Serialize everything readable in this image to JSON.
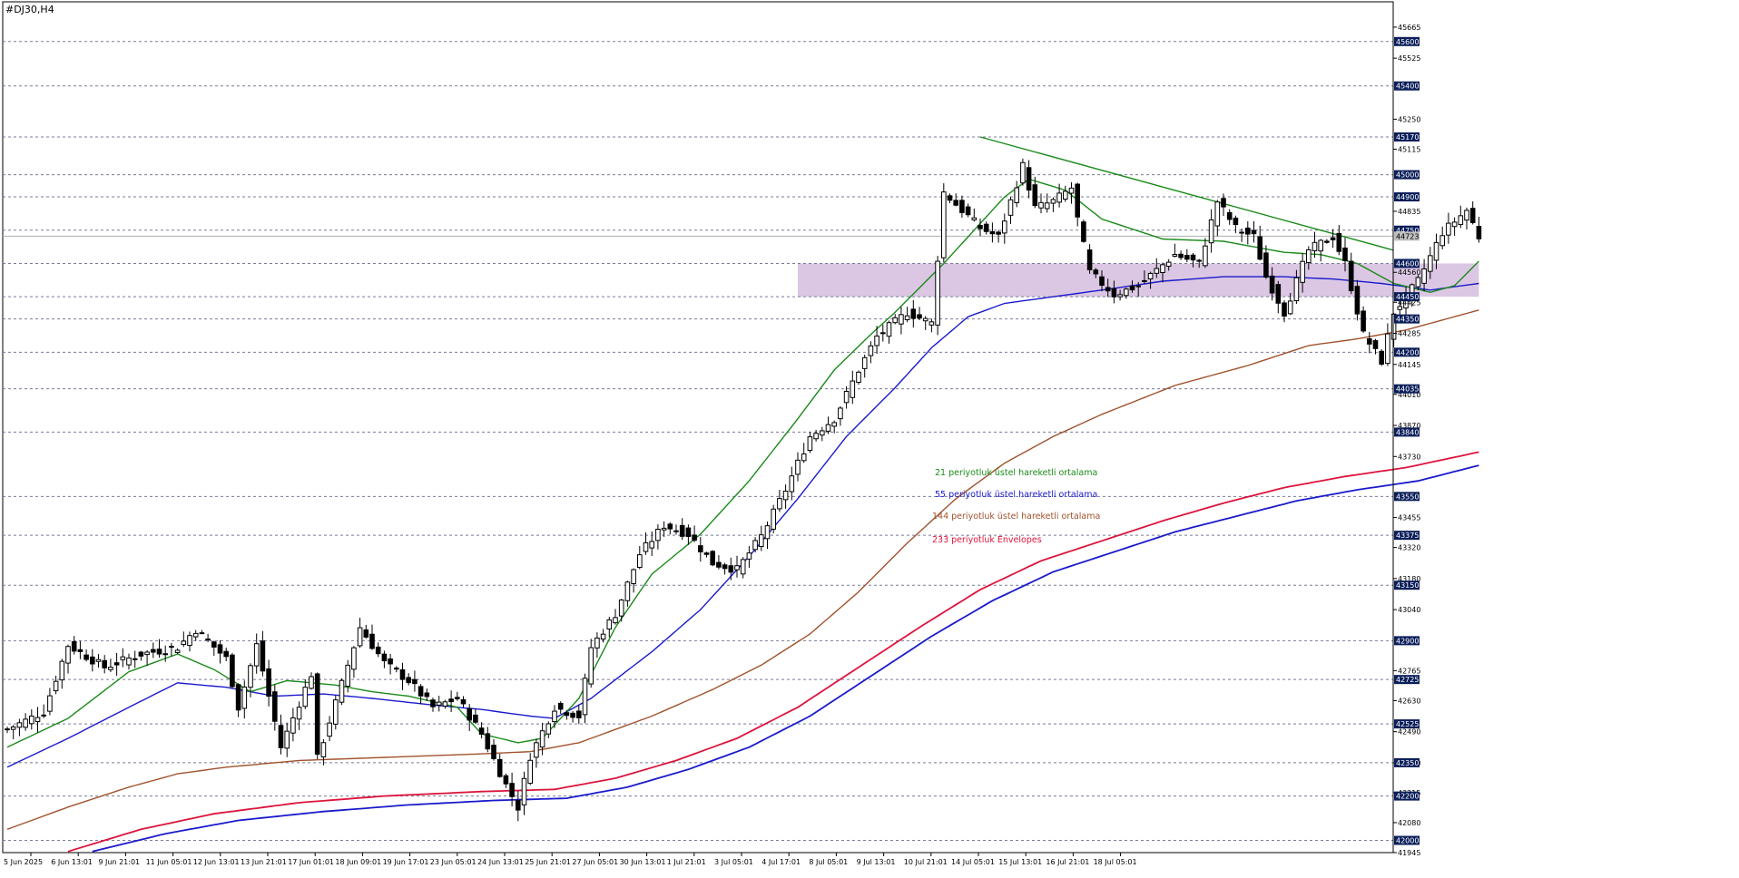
{
  "window_title": "#DJ30,H4",
  "chart_data": {
    "type": "candlestick",
    "symbol": "#DJ30",
    "timeframe": "H4",
    "ylim": [
      41945,
      45730
    ],
    "price_ticks": [
      45665,
      45525,
      45250,
      45115,
      44835,
      44560,
      44425,
      44285,
      44145,
      44010,
      43870,
      43730,
      43455,
      43320,
      43180,
      43040,
      42765,
      42630,
      42490,
      42350,
      42215,
      42080,
      41945
    ],
    "level_lines": [
      45600,
      45400,
      45170,
      45000,
      44900,
      44750,
      44600,
      44450,
      44350,
      44200,
      44035,
      43840,
      43550,
      43375,
      43150,
      42900,
      42725,
      42525,
      42350,
      42200,
      42000
    ],
    "current_price": "44723",
    "x_labels": [
      "5 Jun 2025",
      "6 Jun 13:01",
      "9 Jun 21:01",
      "11 Jun 05:01",
      "12 Jun 13:01",
      "13 Jun 21:01",
      "17 Jun 01:01",
      "18 Jun 09:01",
      "19 Jun 17:01",
      "23 Jun 05:01",
      "24 Jun 13:01",
      "25 Jun 21:01",
      "27 Jun 05:01",
      "30 Jun 13:01",
      "1 Jul 21:01",
      "3 Jul 05:01",
      "4 Jul 17:01",
      "8 Jul 05:01",
      "9 Jul 13:01",
      "10 Jul 21:01",
      "14 Jul 05:01",
      "15 Jul 13:01",
      "16 Jul 21:01",
      "18 Jul 05:01"
    ],
    "candle_anchors": [
      [
        0,
        42500
      ],
      [
        6,
        42580
      ],
      [
        10,
        42880
      ],
      [
        16,
        42780
      ],
      [
        22,
        42840
      ],
      [
        28,
        42870
      ],
      [
        31,
        42950
      ],
      [
        36,
        42820
      ],
      [
        38,
        42600
      ],
      [
        41,
        42880
      ],
      [
        45,
        42420
      ],
      [
        50,
        42750
      ],
      [
        51,
        42370
      ],
      [
        54,
        42620
      ],
      [
        58,
        42960
      ],
      [
        62,
        42800
      ],
      [
        66,
        42720
      ],
      [
        70,
        42600
      ],
      [
        74,
        42640
      ],
      [
        78,
        42480
      ],
      [
        82,
        42250
      ],
      [
        84,
        42150
      ],
      [
        86,
        42380
      ],
      [
        90,
        42600
      ],
      [
        94,
        42560
      ],
      [
        96,
        42870
      ],
      [
        100,
        43020
      ],
      [
        104,
        43290
      ],
      [
        108,
        43420
      ],
      [
        112,
        43380
      ],
      [
        116,
        43250
      ],
      [
        120,
        43220
      ],
      [
        124,
        43370
      ],
      [
        128,
        43580
      ],
      [
        132,
        43820
      ],
      [
        136,
        43900
      ],
      [
        140,
        44120
      ],
      [
        143,
        44270
      ],
      [
        148,
        44380
      ],
      [
        152,
        44330
      ],
      [
        154,
        44920
      ],
      [
        160,
        44760
      ],
      [
        163,
        44720
      ],
      [
        167,
        45040
      ],
      [
        169,
        44850
      ],
      [
        172,
        44880
      ],
      [
        175,
        44940
      ],
      [
        176,
        44800
      ],
      [
        178,
        44560
      ],
      [
        182,
        44460
      ],
      [
        186,
        44500
      ],
      [
        192,
        44640
      ],
      [
        196,
        44600
      ],
      [
        199,
        44880
      ],
      [
        202,
        44760
      ],
      [
        205,
        44720
      ],
      [
        207,
        44540
      ],
      [
        210,
        44380
      ],
      [
        214,
        44660
      ],
      [
        218,
        44720
      ],
      [
        220,
        44600
      ],
      [
        223,
        44280
      ],
      [
        226,
        44160
      ],
      [
        228,
        44380
      ],
      [
        232,
        44520
      ],
      [
        236,
        44740
      ],
      [
        240,
        44840
      ],
      [
        242,
        44720
      ]
    ],
    "ema21_anchors": [
      [
        0,
        42420
      ],
      [
        10,
        42550
      ],
      [
        20,
        42760
      ],
      [
        28,
        42840
      ],
      [
        34,
        42770
      ],
      [
        40,
        42670
      ],
      [
        46,
        42720
      ],
      [
        54,
        42700
      ],
      [
        60,
        42670
      ],
      [
        66,
        42650
      ],
      [
        74,
        42600
      ],
      [
        78,
        42480
      ],
      [
        84,
        42440
      ],
      [
        88,
        42460
      ],
      [
        94,
        42640
      ],
      [
        100,
        42960
      ],
      [
        106,
        43200
      ],
      [
        114,
        43380
      ],
      [
        122,
        43620
      ],
      [
        130,
        43900
      ],
      [
        136,
        44120
      ],
      [
        142,
        44280
      ],
      [
        146,
        44380
      ],
      [
        154,
        44600
      ],
      [
        160,
        44780
      ],
      [
        164,
        44900
      ],
      [
        168,
        44980
      ],
      [
        174,
        44930
      ],
      [
        180,
        44800
      ],
      [
        190,
        44710
      ],
      [
        200,
        44700
      ],
      [
        210,
        44650
      ],
      [
        216,
        44640
      ],
      [
        222,
        44600
      ],
      [
        228,
        44510
      ],
      [
        234,
        44470
      ],
      [
        238,
        44500
      ],
      [
        242,
        44610
      ]
    ],
    "ema55_anchors": [
      [
        0,
        42330
      ],
      [
        10,
        42460
      ],
      [
        20,
        42600
      ],
      [
        28,
        42710
      ],
      [
        36,
        42690
      ],
      [
        44,
        42650
      ],
      [
        52,
        42660
      ],
      [
        60,
        42640
      ],
      [
        70,
        42610
      ],
      [
        78,
        42590
      ],
      [
        86,
        42560
      ],
      [
        90,
        42550
      ],
      [
        96,
        42640
      ],
      [
        106,
        42850
      ],
      [
        114,
        43040
      ],
      [
        122,
        43280
      ],
      [
        130,
        43540
      ],
      [
        138,
        43820
      ],
      [
        146,
        44040
      ],
      [
        152,
        44220
      ],
      [
        158,
        44360
      ],
      [
        164,
        44420
      ],
      [
        172,
        44450
      ],
      [
        180,
        44480
      ],
      [
        190,
        44520
      ],
      [
        200,
        44540
      ],
      [
        210,
        44540
      ],
      [
        218,
        44530
      ],
      [
        226,
        44510
      ],
      [
        234,
        44480
      ],
      [
        242,
        44510
      ]
    ],
    "ema144_anchors": [
      [
        0,
        42050
      ],
      [
        10,
        42150
      ],
      [
        20,
        42240
      ],
      [
        28,
        42300
      ],
      [
        36,
        42330
      ],
      [
        48,
        42360
      ],
      [
        58,
        42370
      ],
      [
        68,
        42380
      ],
      [
        78,
        42390
      ],
      [
        86,
        42400
      ],
      [
        94,
        42440
      ],
      [
        106,
        42560
      ],
      [
        116,
        42680
      ],
      [
        124,
        42790
      ],
      [
        132,
        42930
      ],
      [
        140,
        43120
      ],
      [
        148,
        43340
      ],
      [
        156,
        43540
      ],
      [
        164,
        43700
      ],
      [
        172,
        43820
      ],
      [
        180,
        43920
      ],
      [
        192,
        44050
      ],
      [
        204,
        44140
      ],
      [
        214,
        44230
      ],
      [
        222,
        44260
      ],
      [
        230,
        44300
      ],
      [
        242,
        44390
      ]
    ],
    "env_upper_anchors": [
      [
        10,
        41950
      ],
      [
        22,
        42050
      ],
      [
        34,
        42120
      ],
      [
        48,
        42170
      ],
      [
        62,
        42200
      ],
      [
        78,
        42220
      ],
      [
        90,
        42230
      ],
      [
        100,
        42280
      ],
      [
        110,
        42360
      ],
      [
        120,
        42460
      ],
      [
        130,
        42600
      ],
      [
        140,
        42780
      ],
      [
        150,
        42960
      ],
      [
        160,
        43130
      ],
      [
        170,
        43260
      ],
      [
        180,
        43350
      ],
      [
        190,
        43440
      ],
      [
        200,
        43520
      ],
      [
        210,
        43590
      ],
      [
        220,
        43640
      ],
      [
        230,
        43680
      ],
      [
        242,
        43750
      ]
    ],
    "env_lower_anchors": [
      [
        14,
        41950
      ],
      [
        26,
        42030
      ],
      [
        38,
        42090
      ],
      [
        52,
        42130
      ],
      [
        66,
        42160
      ],
      [
        80,
        42180
      ],
      [
        92,
        42190
      ],
      [
        102,
        42240
      ],
      [
        112,
        42320
      ],
      [
        122,
        42420
      ],
      [
        132,
        42560
      ],
      [
        142,
        42740
      ],
      [
        152,
        42920
      ],
      [
        162,
        43080
      ],
      [
        172,
        43210
      ],
      [
        182,
        43300
      ],
      [
        192,
        43390
      ],
      [
        202,
        43460
      ],
      [
        212,
        43530
      ],
      [
        222,
        43580
      ],
      [
        232,
        43620
      ],
      [
        242,
        43690
      ]
    ],
    "trendline": [
      [
        160,
        45170
      ],
      [
        265,
        44660
      ]
    ],
    "zone": {
      "from_index": 130,
      "to_index": 242,
      "low": 44450,
      "high": 44600,
      "color": "#d7c1e0"
    },
    "legend": [
      {
        "label": "21 periyotluk üstel hareketli ortalama",
        "color": "#1a8a1a"
      },
      {
        "label": "55 periyotluk üstel hareketli ortalama",
        "color": "#1a1acc"
      },
      {
        "label": "144 periyotluk üstel hareketli ortalama",
        "color": "#a0522d"
      },
      {
        "label": "233 periyotluk Envelopes",
        "color": "#dc143c"
      }
    ],
    "colors": {
      "ema21": "#1a8a1a",
      "ema55": "#1a1acc",
      "ema144": "#a0522d",
      "env_upper": "#dc143c",
      "env_lower": "#1a1acc",
      "trendline": "#1a8a1a",
      "candle_up": "#ffffff",
      "candle_down": "#000000",
      "grid": "#7a7a99",
      "current_label_bg": "#c0c0c0",
      "level_label_bg": "#0a1e5a"
    }
  }
}
